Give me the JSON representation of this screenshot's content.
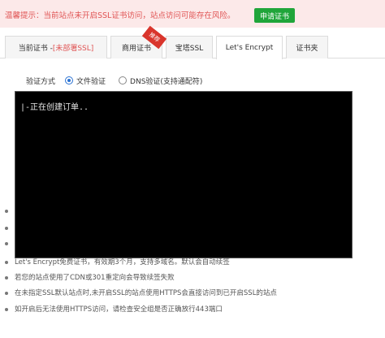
{
  "banner": {
    "warning": "温馨提示：当前站点未开启SSL证书访问，站点访问可能存在风险。",
    "apply_button": "申请证书"
  },
  "tabs": [
    {
      "label": "当前证书 - ",
      "suffix": "[未部署SSL]"
    },
    {
      "label": "商用证书",
      "badge": "推荐"
    },
    {
      "label": "宝塔SSL"
    },
    {
      "label": "Let's Encrypt"
    },
    {
      "label": "证书夹"
    }
  ],
  "active_tab": "Let's Encrypt",
  "verify": {
    "label": "验证方式",
    "options": [
      {
        "label": "文件验证",
        "selected": true
      },
      {
        "label": "DNS验证(支持通配符)",
        "selected": false
      }
    ]
  },
  "terminal": {
    "output": "|-正在创建订单.."
  },
  "notes": [
    "Let's Encrypt免费证书，有效期3个月，支持多域名。默认会自动续签",
    "若您的站点使用了CDN或301重定向会导致续签失败",
    "在未指定SSL默认站点时,未开启SSL的站点使用HTTPS会直接访问到已开启SSL的站点",
    "如开启后无法使用HTTPS访问，请检查安全组是否正确放行443端口"
  ]
}
